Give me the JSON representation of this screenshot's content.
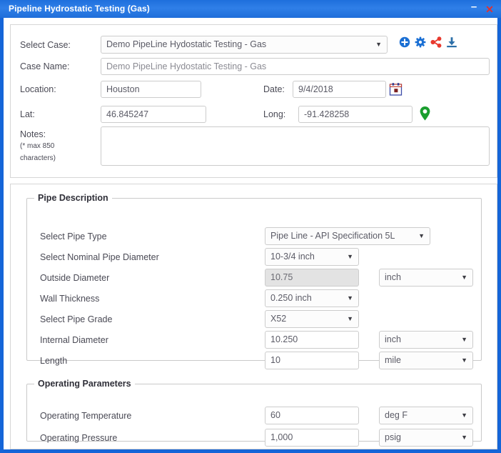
{
  "window": {
    "title": "Pipeline Hydrostatic Testing (Gas)",
    "minimize_label": "–",
    "close_label": "✕",
    "accent_color": "#1565d8",
    "titlebar_color": "#2f7fe8"
  },
  "toolbar": {
    "icons": [
      {
        "name": "add-circle-icon",
        "label": "Add Case",
        "color": "#1a6fd4"
      },
      {
        "name": "gear-icon",
        "label": "Settings",
        "color": "#1a6fd4"
      },
      {
        "name": "share-icon",
        "label": "Share",
        "color": "#e8392e"
      },
      {
        "name": "download-icon",
        "label": "Download",
        "color": "#2c6fa8"
      }
    ]
  },
  "case_section": {
    "select_case": {
      "label": "Select Case:",
      "value": "Demo PipeLine Hydostatic Testing - Gas"
    },
    "case_name": {
      "label": "Case Name:",
      "value": "Demo  PipeLine Hydostatic Testing - Gas"
    },
    "location": {
      "label": "Location:",
      "value": "Houston"
    },
    "date": {
      "label": "Date:",
      "value": "9/4/2018",
      "icon": "calendar-icon"
    },
    "lat": {
      "label": "Lat:",
      "value": "46.845247"
    },
    "long": {
      "label": "Long:",
      "value": "-91.428258",
      "icon": "map-pin-icon",
      "icon_color": "#1a9e2e"
    },
    "notes": {
      "label": "Notes:",
      "hint_line1": "(* max 850",
      "hint_line2": "characters)",
      "value": ""
    }
  },
  "pipe_description": {
    "legend": "Pipe Description",
    "rows": [
      {
        "label": "Select Pipe Type",
        "control": "select",
        "value": "Pipe Line - API Specification 5L",
        "wide": true,
        "unit": null
      },
      {
        "label": "Select Nominal Pipe Diameter",
        "control": "select",
        "value": "10-3/4 inch",
        "wide": false,
        "unit": null
      },
      {
        "label": "Outside Diameter",
        "control": "input-disabled",
        "value": "10.75",
        "wide": false,
        "unit": "inch"
      },
      {
        "label": "Wall Thickness",
        "control": "select",
        "value": "0.250 inch",
        "wide": false,
        "unit": null
      },
      {
        "label": "Select Pipe Grade",
        "control": "select",
        "value": "X52",
        "wide": false,
        "unit": null
      },
      {
        "label": "Internal Diameter",
        "control": "input",
        "value": "10.250",
        "wide": false,
        "unit": "inch"
      },
      {
        "label": "Length",
        "control": "input",
        "value": "10",
        "wide": false,
        "unit": "mile"
      }
    ]
  },
  "operating_parameters": {
    "legend": "Operating Parameters",
    "rows": [
      {
        "label": "Operating Temperature",
        "value": "60",
        "unit": "deg F"
      },
      {
        "label": "Operating Pressure",
        "value": "1,000",
        "unit": "psig"
      }
    ]
  },
  "icons": {
    "caret_down": "▼"
  }
}
